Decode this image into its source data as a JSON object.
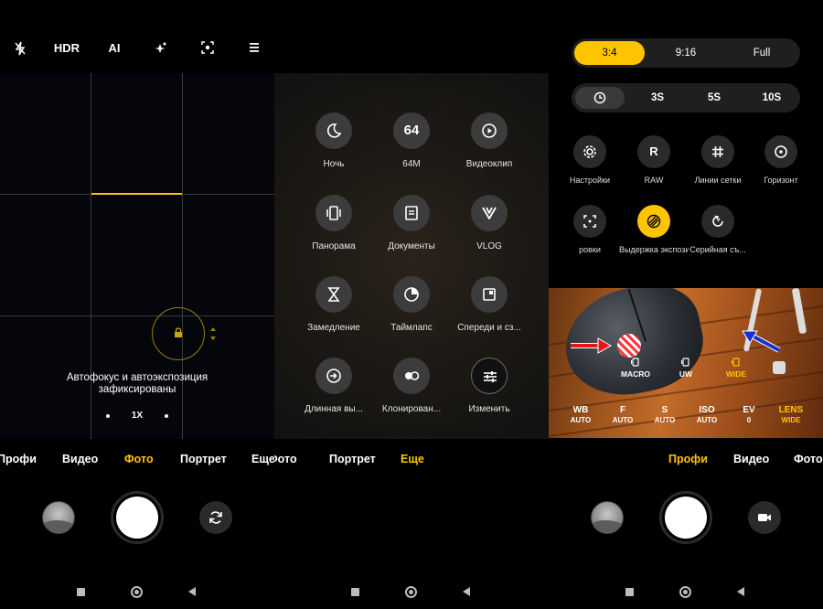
{
  "panel1": {
    "top_icons": [
      {
        "name": "flash-off-icon",
        "label": ""
      },
      {
        "name": "hdr-toggle",
        "label": "HDR"
      },
      {
        "name": "ai-toggle",
        "label": "AI"
      },
      {
        "name": "beauty-icon",
        "label": ""
      },
      {
        "name": "google-lens-icon",
        "label": ""
      },
      {
        "name": "menu-icon",
        "label": ""
      }
    ],
    "af_message_line1": "Автофокус и автоэкспозиция",
    "af_message_line2": "зафиксированы",
    "zoom": "1X",
    "modes": [
      {
        "label": "Профи",
        "active": false
      },
      {
        "label": "Видео",
        "active": false
      },
      {
        "label": "Фото",
        "active": true
      },
      {
        "label": "Портрет",
        "active": false
      },
      {
        "label": "Еще",
        "active": false
      }
    ]
  },
  "panel2": {
    "grid": [
      {
        "label": "Ночь",
        "icon": "moon-icon"
      },
      {
        "label": "64M",
        "icon": "text",
        "text": "64"
      },
      {
        "label": "Видеоклип",
        "icon": "play-icon"
      },
      {
        "label": "Панорама",
        "icon": "panorama-icon"
      },
      {
        "label": "Документы",
        "icon": "document-icon"
      },
      {
        "label": "VLOG",
        "icon": "vlog-icon"
      },
      {
        "label": "Замедление",
        "icon": "hourglass-icon"
      },
      {
        "label": "Таймлапс",
        "icon": "timelapse-icon"
      },
      {
        "label": "Спереди и сз...",
        "icon": "dual-view-icon"
      },
      {
        "label": "Длинная вы...",
        "icon": "long-exposure-icon"
      },
      {
        "label": "Клонирован...",
        "icon": "clone-icon"
      },
      {
        "label": "Изменить",
        "icon": "sliders-icon"
      }
    ],
    "modes": [
      {
        "label": "Фото",
        "active": false
      },
      {
        "label": "Портрет",
        "active": false
      },
      {
        "label": "Еще",
        "active": true
      }
    ]
  },
  "panel3": {
    "ratios": [
      {
        "label": "3:4",
        "selected": true
      },
      {
        "label": "9:16",
        "selected": false
      },
      {
        "label": "Full",
        "selected": false
      }
    ],
    "timers": [
      {
        "label": "",
        "selected": true
      },
      {
        "label": "3S",
        "selected": false
      },
      {
        "label": "5S",
        "selected": false
      },
      {
        "label": "10S",
        "selected": false
      }
    ],
    "settings_row1": [
      {
        "label": "Настройки",
        "icon": "gear-icon"
      },
      {
        "label": "RAW",
        "icon": "text",
        "text": "R"
      },
      {
        "label": "Линии сетки",
        "icon": "grid-icon"
      },
      {
        "label": "Горизонт",
        "icon": "level-icon"
      }
    ],
    "settings_row2": [
      {
        "label": "ровки",
        "icon": "focus-frame-icon",
        "active": false
      },
      {
        "label": "Выдержка экспозиции",
        "icon": "exposure-stripes-icon",
        "active": true
      },
      {
        "label": "Серийная съ...",
        "icon": "burst-icon",
        "active": false
      }
    ],
    "lenses": [
      {
        "label": "MACRO",
        "selected": false
      },
      {
        "label": "UW",
        "selected": false
      },
      {
        "label": "WIDE",
        "selected": true
      }
    ],
    "params": [
      {
        "name": "WB",
        "value": "AUTO",
        "selected": false
      },
      {
        "name": "F",
        "value": "AUTO",
        "selected": false
      },
      {
        "name": "S",
        "value": "AUTO",
        "selected": false
      },
      {
        "name": "ISO",
        "value": "AUTO",
        "selected": false
      },
      {
        "name": "EV",
        "value": "0",
        "selected": false
      },
      {
        "name": "LENS",
        "value": "WIDE",
        "selected": true
      }
    ],
    "modes": [
      {
        "label": "Профи",
        "active": true
      },
      {
        "label": "Видео",
        "active": false
      },
      {
        "label": "Фото",
        "active": false
      }
    ]
  },
  "colors": {
    "accent": "#ffc400",
    "background": "#000000"
  }
}
